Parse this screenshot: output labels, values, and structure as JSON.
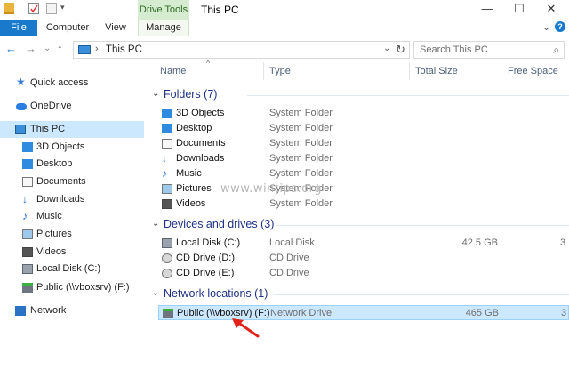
{
  "window": {
    "title": "This PC",
    "context_tab_group": "Drive Tools",
    "minimize_glyph": "—",
    "maximize_glyph": "☐",
    "close_glyph": "✕"
  },
  "ribbon": {
    "tabs": [
      {
        "label": "File"
      },
      {
        "label": "Computer"
      },
      {
        "label": "View"
      },
      {
        "label": "Manage"
      }
    ],
    "collapse_glyph": "⌄",
    "help_glyph": "?"
  },
  "nav": {
    "back_glyph": "←",
    "forward_glyph": "→",
    "recent_glyph": "⌄",
    "up_glyph": "↑",
    "address_sep": "›",
    "address_crumb": "This PC",
    "address_dropdown": "⌄",
    "refresh_glyph": "↻",
    "search_placeholder": "Search This PC",
    "search_glyph": "⌕"
  },
  "sidebar": {
    "items": [
      {
        "label": "Quick access",
        "icon": "star-icon"
      },
      {
        "label": "OneDrive",
        "icon": "cloud-icon"
      },
      {
        "label": "This PC",
        "icon": "computer-icon",
        "selected": true
      },
      {
        "label": "3D Objects",
        "icon": "3d-objects-icon"
      },
      {
        "label": "Desktop",
        "icon": "desktop-icon"
      },
      {
        "label": "Documents",
        "icon": "documents-icon"
      },
      {
        "label": "Downloads",
        "icon": "downloads-icon"
      },
      {
        "label": "Music",
        "icon": "music-icon"
      },
      {
        "label": "Pictures",
        "icon": "pictures-icon"
      },
      {
        "label": "Videos",
        "icon": "videos-icon"
      },
      {
        "label": "Local Disk (C:)",
        "icon": "local-disk-icon"
      },
      {
        "label": "Public (\\\\vboxsrv) (F:)",
        "icon": "network-drive-icon"
      },
      {
        "label": "Network",
        "icon": "network-icon"
      }
    ]
  },
  "columns": {
    "name": "Name",
    "type": "Type",
    "total_size": "Total Size",
    "free_space": "Free Space",
    "sort_glyph": "^"
  },
  "groups": {
    "folders": {
      "title": "Folders (7)",
      "rows": [
        {
          "name": "3D Objects",
          "type": "System Folder"
        },
        {
          "name": "Desktop",
          "type": "System Folder"
        },
        {
          "name": "Documents",
          "type": "System Folder"
        },
        {
          "name": "Downloads",
          "type": "System Folder"
        },
        {
          "name": "Music",
          "type": "System Folder"
        },
        {
          "name": "Pictures",
          "type": "System Folder"
        },
        {
          "name": "Videos",
          "type": "System Folder"
        }
      ]
    },
    "devices": {
      "title": "Devices and drives (3)",
      "rows": [
        {
          "name": "Local Disk (C:)",
          "type": "Local Disk",
          "size": "42.5 GB",
          "free": "3"
        },
        {
          "name": "CD Drive (D:)",
          "type": "CD Drive"
        },
        {
          "name": "CD Drive (E:)",
          "type": "CD Drive"
        }
      ]
    },
    "network": {
      "title": "Network locations (1)",
      "rows": [
        {
          "name": "Public (\\\\vboxsrv) (F:)",
          "type": "Network Drive",
          "size": "465 GB",
          "free": "3"
        }
      ]
    }
  },
  "group_chevron": "⌄",
  "watermark": "www.wintips.org",
  "colors": {
    "selection": "#cce8ff",
    "file_tab": "#1979ca",
    "context_tab": "#d6ecd0",
    "group_title": "#1e3287",
    "annotation_arrow": "#e2231a"
  }
}
